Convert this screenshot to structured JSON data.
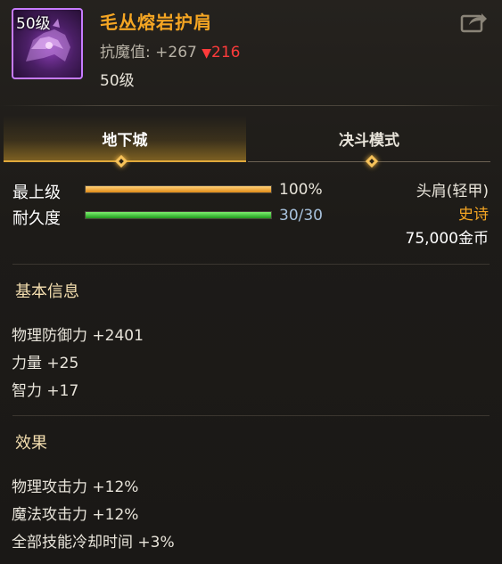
{
  "item": {
    "level_tag": "50级",
    "name": "毛丛熔岩护肩",
    "resist_label": "抗魔值: +267",
    "resist_delta": "216",
    "resist_delta_symbol": "▼",
    "required_level": "50级",
    "icon": "purple-shoulder-armor-icon"
  },
  "share_icon": "share-export-icon",
  "tabs": [
    {
      "label": "地下城",
      "active": true
    },
    {
      "label": "决斗模式",
      "active": false
    }
  ],
  "stats": {
    "grade_label": "最上级",
    "grade_value": "100%",
    "grade_fraction": 1.0,
    "durability_label": "耐久度",
    "durability_value": "30/30",
    "durability_fraction": 1.0
  },
  "info": {
    "slot": "头肩(轻甲)",
    "rarity": "史诗",
    "price": "75,000金币"
  },
  "basic": {
    "title": "基本信息",
    "lines": [
      "物理防御力 +2401",
      "力量 +25",
      "智力 +17"
    ]
  },
  "effect": {
    "title": "效果",
    "lines": [
      "物理攻击力 +12%",
      "魔法攻击力 +12%",
      "全部技能冷却时间 +3%"
    ]
  },
  "colors": {
    "name": "#f5a623",
    "epic": "#f5a623",
    "delta_down": "#ff3b3b",
    "icon_border": "#c77bff"
  }
}
